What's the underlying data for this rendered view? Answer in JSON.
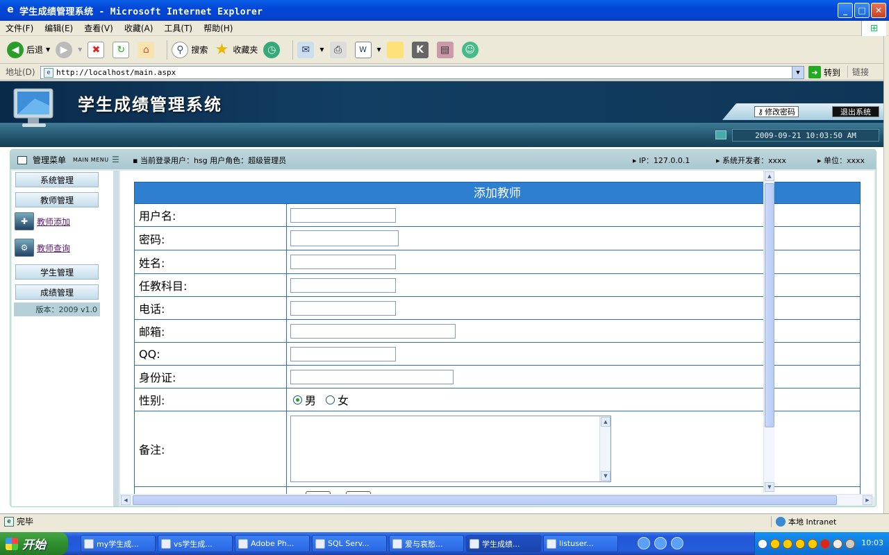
{
  "window": {
    "title": "学生成绩管理系统 - Microsoft Internet Explorer",
    "controls": {
      "minimize": "_",
      "maximize": "□",
      "close": "✕"
    }
  },
  "menubar": {
    "items": [
      "文件(F)",
      "编辑(E)",
      "查看(V)",
      "收藏(A)",
      "工具(T)",
      "帮助(H)"
    ]
  },
  "toolbar": {
    "back": "后退",
    "search": "搜索",
    "favorites": "收藏夹"
  },
  "address": {
    "label": "地址(D)",
    "url": "http://localhost/main.aspx",
    "go": "转到",
    "links": "链接"
  },
  "site": {
    "title": "学生成绩管理系统",
    "change_password": "修改密码",
    "logout": "退出系统",
    "datetime": "2009-09-21 10:03:50 AM"
  },
  "infobar": {
    "menu_title": "管理菜单",
    "menu_title_en": "MAIN MENU",
    "current_user": "当前登录用户：hsg  用户角色：超级管理员",
    "ip": "IP：127.0.0.1",
    "developer": "系统开发者：xxxx",
    "unit": "单位：xxxx"
  },
  "sidebar": {
    "system_mgmt": "系统管理",
    "teacher_mgmt": "教师管理",
    "teacher_add": "教师添加",
    "teacher_query": "教师查询",
    "student_mgmt": "学生管理",
    "score_mgmt": "成绩管理",
    "version": "版本：2009 v1.0"
  },
  "form": {
    "title": "添加教师",
    "username": "用户名:",
    "password": "密码:",
    "name": "姓名:",
    "subject": "任教科目:",
    "phone": "电话:",
    "email": "邮箱:",
    "qq": "QQ:",
    "idcard": "身份证:",
    "gender": "性别:",
    "male": "男",
    "female": "女",
    "remark": "备注:"
  },
  "status": {
    "text": "完毕",
    "zone": "本地 Intranet"
  },
  "taskbar": {
    "start": "开始",
    "tasks": [
      "my学生成...",
      "vs学生成...",
      "Adobe Ph...",
      "SQL Serv...",
      "爱与哀愁...",
      "学生成绩...",
      "listuser..."
    ],
    "clock": "10:03"
  }
}
